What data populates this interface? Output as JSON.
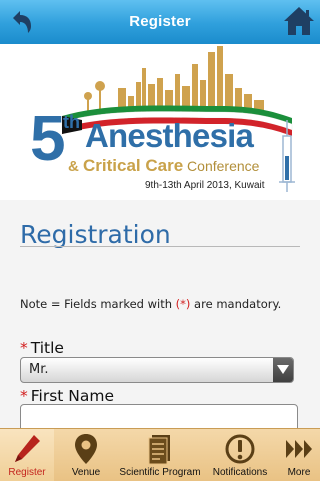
{
  "header": {
    "title": "Register",
    "back_icon": "back-arrow-icon",
    "home_icon": "home-icon",
    "color": "#2f9fdc"
  },
  "banner": {
    "edition_number": "5",
    "edition_suffix": "th",
    "name_main": "Anesthesia",
    "name_sub_amp": "& ",
    "name_sub_bold": "Critical Care",
    "name_sub_tail": " Conference",
    "date_text": "9th-13th April 2013, Kuwait",
    "brand_blue": "#2f6fa8",
    "brand_gold": "#c9a24a"
  },
  "form": {
    "section_title": "Registration",
    "note_prefix": "Note = Fields marked with ",
    "note_marker": "(*)",
    "note_suffix": " are mandatory.",
    "fields": [
      {
        "label": "Title",
        "required_mark": "*",
        "type": "select",
        "value": "Mr."
      },
      {
        "label": "First Name",
        "required_mark": "*",
        "type": "text",
        "value": ""
      }
    ]
  },
  "tabbar": {
    "items": [
      {
        "label": "Register",
        "icon": "pencil-icon",
        "active": true
      },
      {
        "label": "Venue",
        "icon": "map-pin-icon",
        "active": false
      },
      {
        "label": "Scientific Program",
        "icon": "document-icon",
        "active": false
      },
      {
        "label": "Notifications",
        "icon": "alert-icon",
        "active": false
      },
      {
        "label": "More",
        "icon": "more-arrows-icon",
        "active": false
      }
    ],
    "active_color": "#c4261e"
  }
}
